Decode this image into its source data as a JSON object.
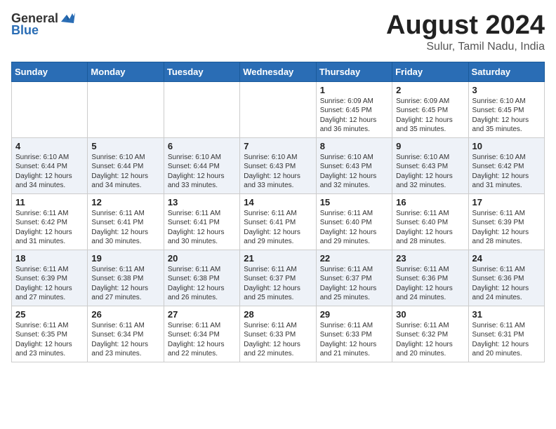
{
  "header": {
    "logo_general": "General",
    "logo_blue": "Blue",
    "month_year": "August 2024",
    "location": "Sulur, Tamil Nadu, India"
  },
  "days_of_week": [
    "Sunday",
    "Monday",
    "Tuesday",
    "Wednesday",
    "Thursday",
    "Friday",
    "Saturday"
  ],
  "weeks": [
    [
      {
        "day": "",
        "info": ""
      },
      {
        "day": "",
        "info": ""
      },
      {
        "day": "",
        "info": ""
      },
      {
        "day": "",
        "info": ""
      },
      {
        "day": "1",
        "info": "Sunrise: 6:09 AM\nSunset: 6:45 PM\nDaylight: 12 hours\nand 36 minutes."
      },
      {
        "day": "2",
        "info": "Sunrise: 6:09 AM\nSunset: 6:45 PM\nDaylight: 12 hours\nand 35 minutes."
      },
      {
        "day": "3",
        "info": "Sunrise: 6:10 AM\nSunset: 6:45 PM\nDaylight: 12 hours\nand 35 minutes."
      }
    ],
    [
      {
        "day": "4",
        "info": "Sunrise: 6:10 AM\nSunset: 6:44 PM\nDaylight: 12 hours\nand 34 minutes."
      },
      {
        "day": "5",
        "info": "Sunrise: 6:10 AM\nSunset: 6:44 PM\nDaylight: 12 hours\nand 34 minutes."
      },
      {
        "day": "6",
        "info": "Sunrise: 6:10 AM\nSunset: 6:44 PM\nDaylight: 12 hours\nand 33 minutes."
      },
      {
        "day": "7",
        "info": "Sunrise: 6:10 AM\nSunset: 6:43 PM\nDaylight: 12 hours\nand 33 minutes."
      },
      {
        "day": "8",
        "info": "Sunrise: 6:10 AM\nSunset: 6:43 PM\nDaylight: 12 hours\nand 32 minutes."
      },
      {
        "day": "9",
        "info": "Sunrise: 6:10 AM\nSunset: 6:43 PM\nDaylight: 12 hours\nand 32 minutes."
      },
      {
        "day": "10",
        "info": "Sunrise: 6:10 AM\nSunset: 6:42 PM\nDaylight: 12 hours\nand 31 minutes."
      }
    ],
    [
      {
        "day": "11",
        "info": "Sunrise: 6:11 AM\nSunset: 6:42 PM\nDaylight: 12 hours\nand 31 minutes."
      },
      {
        "day": "12",
        "info": "Sunrise: 6:11 AM\nSunset: 6:41 PM\nDaylight: 12 hours\nand 30 minutes."
      },
      {
        "day": "13",
        "info": "Sunrise: 6:11 AM\nSunset: 6:41 PM\nDaylight: 12 hours\nand 30 minutes."
      },
      {
        "day": "14",
        "info": "Sunrise: 6:11 AM\nSunset: 6:41 PM\nDaylight: 12 hours\nand 29 minutes."
      },
      {
        "day": "15",
        "info": "Sunrise: 6:11 AM\nSunset: 6:40 PM\nDaylight: 12 hours\nand 29 minutes."
      },
      {
        "day": "16",
        "info": "Sunrise: 6:11 AM\nSunset: 6:40 PM\nDaylight: 12 hours\nand 28 minutes."
      },
      {
        "day": "17",
        "info": "Sunrise: 6:11 AM\nSunset: 6:39 PM\nDaylight: 12 hours\nand 28 minutes."
      }
    ],
    [
      {
        "day": "18",
        "info": "Sunrise: 6:11 AM\nSunset: 6:39 PM\nDaylight: 12 hours\nand 27 minutes."
      },
      {
        "day": "19",
        "info": "Sunrise: 6:11 AM\nSunset: 6:38 PM\nDaylight: 12 hours\nand 27 minutes."
      },
      {
        "day": "20",
        "info": "Sunrise: 6:11 AM\nSunset: 6:38 PM\nDaylight: 12 hours\nand 26 minutes."
      },
      {
        "day": "21",
        "info": "Sunrise: 6:11 AM\nSunset: 6:37 PM\nDaylight: 12 hours\nand 25 minutes."
      },
      {
        "day": "22",
        "info": "Sunrise: 6:11 AM\nSunset: 6:37 PM\nDaylight: 12 hours\nand 25 minutes."
      },
      {
        "day": "23",
        "info": "Sunrise: 6:11 AM\nSunset: 6:36 PM\nDaylight: 12 hours\nand 24 minutes."
      },
      {
        "day": "24",
        "info": "Sunrise: 6:11 AM\nSunset: 6:36 PM\nDaylight: 12 hours\nand 24 minutes."
      }
    ],
    [
      {
        "day": "25",
        "info": "Sunrise: 6:11 AM\nSunset: 6:35 PM\nDaylight: 12 hours\nand 23 minutes."
      },
      {
        "day": "26",
        "info": "Sunrise: 6:11 AM\nSunset: 6:34 PM\nDaylight: 12 hours\nand 23 minutes."
      },
      {
        "day": "27",
        "info": "Sunrise: 6:11 AM\nSunset: 6:34 PM\nDaylight: 12 hours\nand 22 minutes."
      },
      {
        "day": "28",
        "info": "Sunrise: 6:11 AM\nSunset: 6:33 PM\nDaylight: 12 hours\nand 22 minutes."
      },
      {
        "day": "29",
        "info": "Sunrise: 6:11 AM\nSunset: 6:33 PM\nDaylight: 12 hours\nand 21 minutes."
      },
      {
        "day": "30",
        "info": "Sunrise: 6:11 AM\nSunset: 6:32 PM\nDaylight: 12 hours\nand 20 minutes."
      },
      {
        "day": "31",
        "info": "Sunrise: 6:11 AM\nSunset: 6:31 PM\nDaylight: 12 hours\nand 20 minutes."
      }
    ]
  ]
}
